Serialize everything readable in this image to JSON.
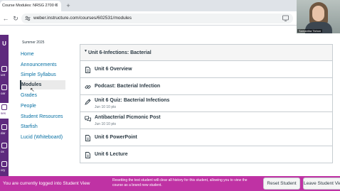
{
  "browser": {
    "tab_title": "Course Modules: NRSG 2700 C",
    "tab_close": "✕",
    "new_tab": "+",
    "back": "←",
    "forward": "→",
    "reload": "↻",
    "url": "weber.instructure.com/courses/602531/modules"
  },
  "webcam": {
    "name_label": "Samantha Tichon"
  },
  "global_nav": {
    "logo": "U",
    "items": [
      {
        "label": "unt",
        "icon": "account-icon"
      },
      {
        "label": "oar",
        "icon": "dashboard-icon"
      },
      {
        "label": "ses",
        "icon": "courses-icon"
      },
      {
        "label": "dar",
        "icon": "calendar-icon"
      },
      {
        "label": "ox",
        "icon": "inbox-icon"
      },
      {
        "label": "ory",
        "icon": "history-icon"
      }
    ]
  },
  "course_nav": {
    "term": "Summer 2025",
    "items": [
      {
        "label": "Home"
      },
      {
        "label": "Announcements"
      },
      {
        "label": "Simple Syllabus"
      },
      {
        "label": "Modules"
      },
      {
        "label": "Grades"
      },
      {
        "label": "People"
      },
      {
        "label": "Student Resources"
      },
      {
        "label": "Starfish"
      },
      {
        "label": "Lucid (Whiteboard)"
      }
    ]
  },
  "module": {
    "caret": "▼",
    "title": "Unit 6-Infections: Bacterial",
    "items": [
      {
        "title": "Unit 6 Overview",
        "icon": "page-icon",
        "meta": ""
      },
      {
        "title": "Podcast: Bacterial Infection",
        "icon": "link-icon",
        "meta": ""
      },
      {
        "title": "Unit 6 Quiz: Bacterial Infections",
        "icon": "quiz-icon",
        "meta": "Jun 10   10 pts"
      },
      {
        "title": "Antibacterial Picmonic Post",
        "icon": "discussion-icon",
        "meta": "Jun 10   10 pts"
      },
      {
        "title": "Unit 6 PowerPoint",
        "icon": "page-icon",
        "meta": ""
      },
      {
        "title": "Unit 6 Lecture",
        "icon": "page-icon",
        "meta": ""
      }
    ]
  },
  "student_view": {
    "message": "You are currently logged into Student View",
    "note": "Resetting the test student will clear all history for this student, allowing you to view the course as a brand new student.",
    "reset_label": "Reset Student",
    "leave_label": "Leave Student View"
  },
  "colors": {
    "global_nav": "#5e2a7e",
    "student_banner": "#bf32a4",
    "link": "#0770a3"
  }
}
